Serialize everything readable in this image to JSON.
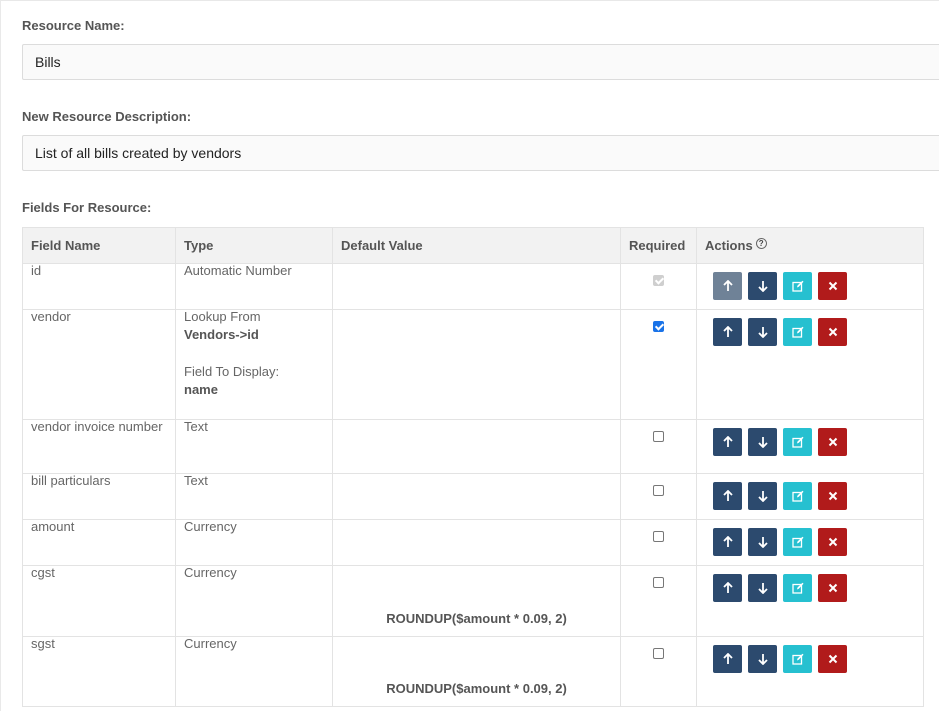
{
  "resource": {
    "name_label": "Resource Name:",
    "name_value": "Bills",
    "desc_label": "New Resource Description:",
    "desc_value": "List of all bills created by vendors",
    "fields_label": "Fields For Resource:"
  },
  "table": {
    "headers": {
      "field_name": "Field Name",
      "type": "Type",
      "default_value": "Default Value",
      "required": "Required",
      "actions": "Actions"
    },
    "rows": [
      {
        "field_name": "id",
        "type": "Automatic Number",
        "default": "",
        "required": "checked-disabled"
      },
      {
        "field_name": "vendor",
        "type": "Lookup From",
        "lookup_ref": "Vendors->id",
        "display_label": "Field To Display:",
        "display_value": "name",
        "default": "",
        "required": "checked"
      },
      {
        "field_name": "vendor invoice number",
        "type": "Text",
        "default": "",
        "required": "unchecked"
      },
      {
        "field_name": "bill particulars",
        "type": "Text",
        "default": "",
        "required": "unchecked"
      },
      {
        "field_name": "amount",
        "type": "Currency",
        "default": "",
        "required": "unchecked"
      },
      {
        "field_name": "cgst",
        "type": "Currency",
        "default": "ROUNDUP($amount * 0.09, 2)",
        "required": "unchecked"
      },
      {
        "field_name": "sgst",
        "type": "Currency",
        "default": "ROUNDUP($amount * 0.09, 2)",
        "required": "unchecked"
      }
    ]
  },
  "icons": {
    "up": "arrow-up-icon",
    "down": "arrow-down-icon",
    "edit": "edit-icon",
    "delete": "close-icon",
    "help": "question-circle-icon"
  },
  "colors": {
    "move_button": "#2c4a6e",
    "edit_button": "#26c0d0",
    "delete_button": "#b11b1b",
    "checkbox_checked": "#1a73e8"
  }
}
